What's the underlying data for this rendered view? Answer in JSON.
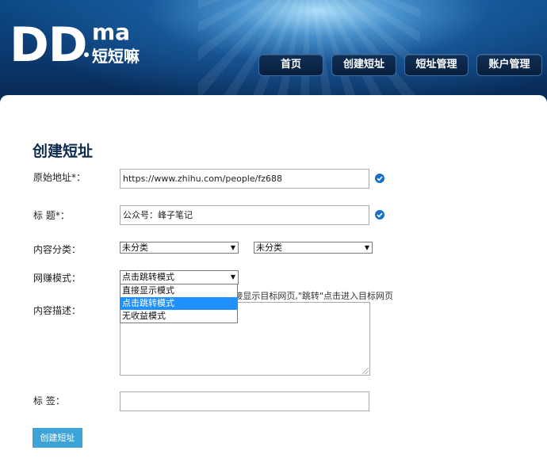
{
  "logo": {
    "mark": "DD",
    "suffix": "ma",
    "name_cn": "短短嘛"
  },
  "nav": [
    {
      "label": "首页"
    },
    {
      "label": "创建短址"
    },
    {
      "label": "短址管理"
    },
    {
      "label": "账户管理"
    }
  ],
  "form": {
    "title": "创建短址",
    "original_url": {
      "label": "原始地址*：",
      "value": "https://www.zhihu.com/people/fz688"
    },
    "title_field": {
      "label": "标 题*：",
      "value": "公众号：峰子笔记"
    },
    "category": {
      "label": "内容分类：",
      "primary": "未分类",
      "secondary": "未分类"
    },
    "earn_mode": {
      "label": "网赚模式：",
      "value": "点击跳转模式",
      "options": [
        "直接显示模式",
        "点击跳转模式",
        "无收益模式"
      ],
      "hint": "接显示目标网页,\"跳转\"点击进入目标网页"
    },
    "description": {
      "label": "内容描述：",
      "value": ""
    },
    "tags": {
      "label": "标 签：",
      "value": ""
    },
    "submit_label": "创建短址"
  },
  "colors": {
    "accent": "#3da3d8",
    "nav_bg": "#0a1f3d",
    "title": "#0d2b4e",
    "check": "#1a6fc4"
  }
}
